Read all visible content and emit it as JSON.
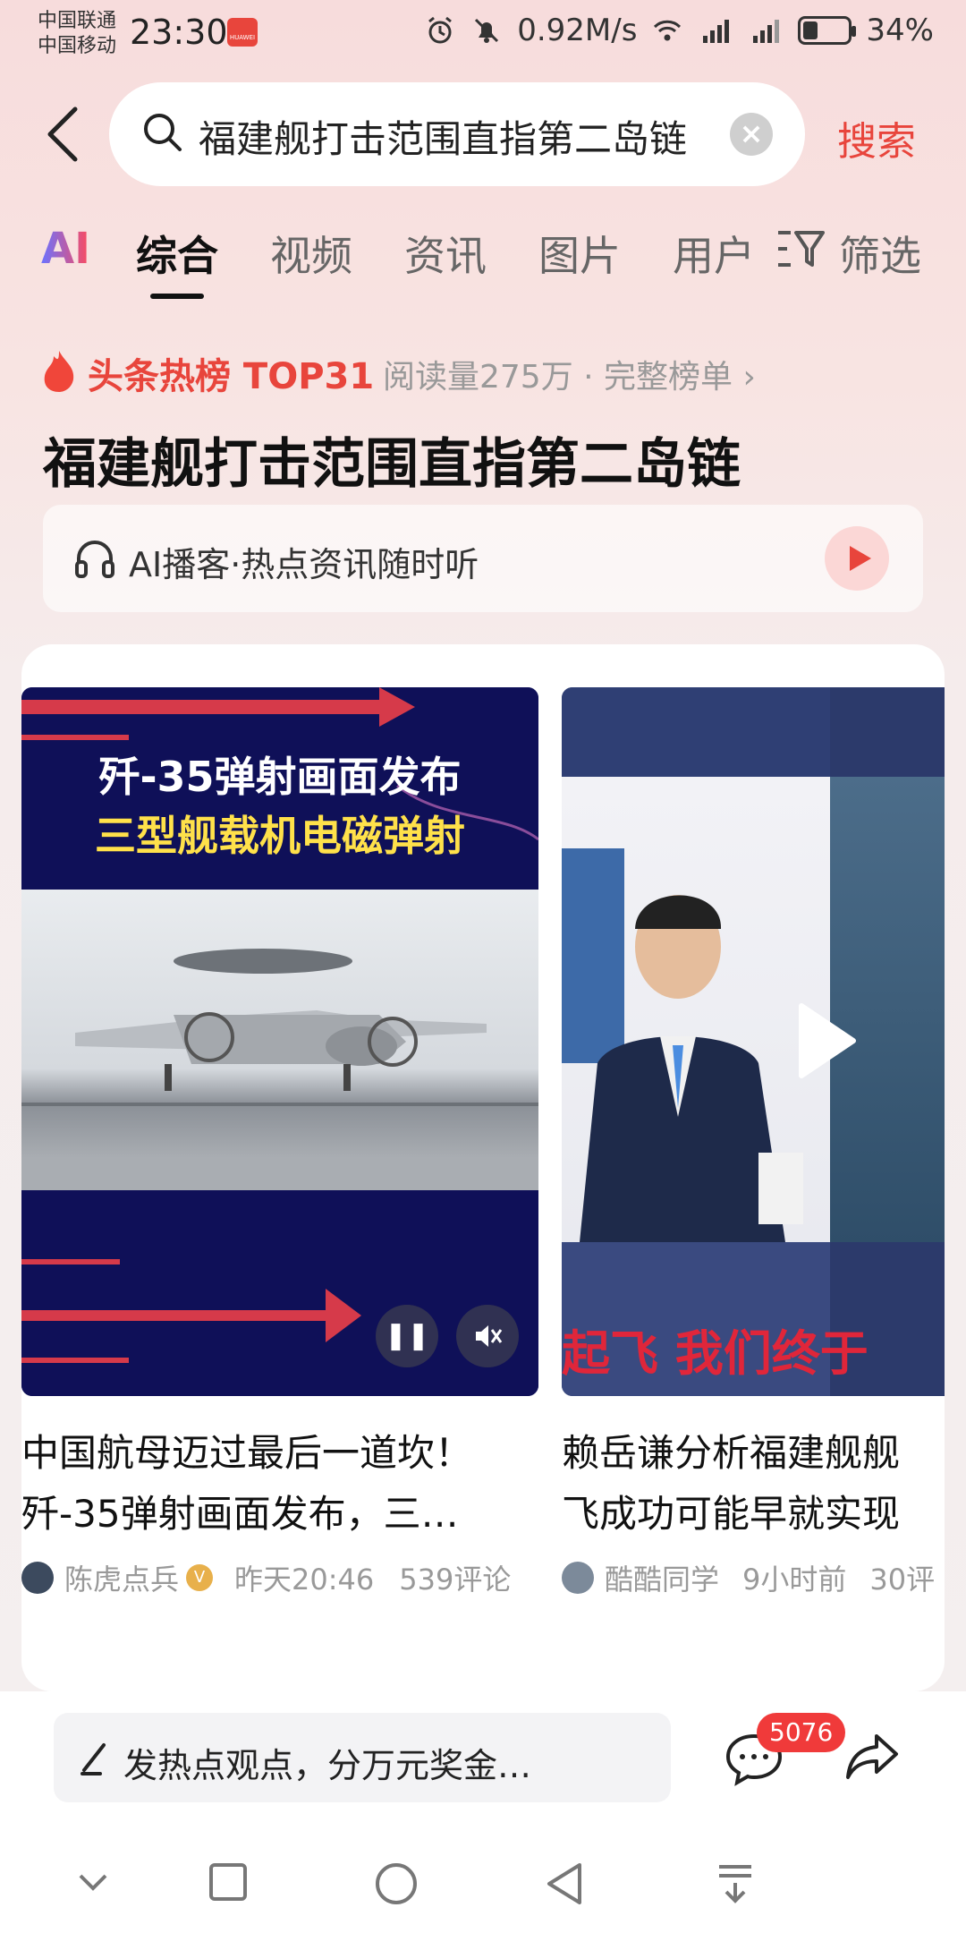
{
  "status_bar": {
    "carrier1": "中国联通",
    "carrier2": "中国移动",
    "time": "23:30",
    "badge_text": "HUAWEI",
    "speed": "0.92M/s",
    "battery_percent": "34%",
    "battery_level": 0.34
  },
  "search": {
    "query": "福建舰打击范围直指第二岛链",
    "submit_label": "搜索"
  },
  "tabs": [
    "AI",
    "综合",
    "视频",
    "资讯",
    "图片",
    "用户"
  ],
  "filter_label": "筛选",
  "hot": {
    "label": "头条热榜 TOP31",
    "meta": "阅读量275万 · 完整榜单",
    "title": "福建舰打击范围直指第二岛链"
  },
  "podcast": {
    "label": "AI播客·热点资讯随时听"
  },
  "videos": [
    {
      "overlay_line1": "歼-35弹射画面发布",
      "overlay_line2": "三型舰载机电磁弹射",
      "caption": "中国航母迈过最后一道坎！歼-35弹射画面发布，三…",
      "author": "陈虎点兵",
      "time": "昨天20:46",
      "comments": "539评论"
    },
    {
      "overlay_text": "起飞 我们终于",
      "caption_line1": "赖岳谦分析福建舰舰",
      "caption_line2": "飞成功可能早就实现",
      "author": "酷酷同学",
      "time": "9小时前",
      "comments": "30评"
    }
  ],
  "comment_bar": {
    "placeholder": "发热点观点，分万元奖金…",
    "badge_count": "5076"
  },
  "colors": {
    "accent": "#e8453c",
    "badge": "#f03a3a"
  }
}
